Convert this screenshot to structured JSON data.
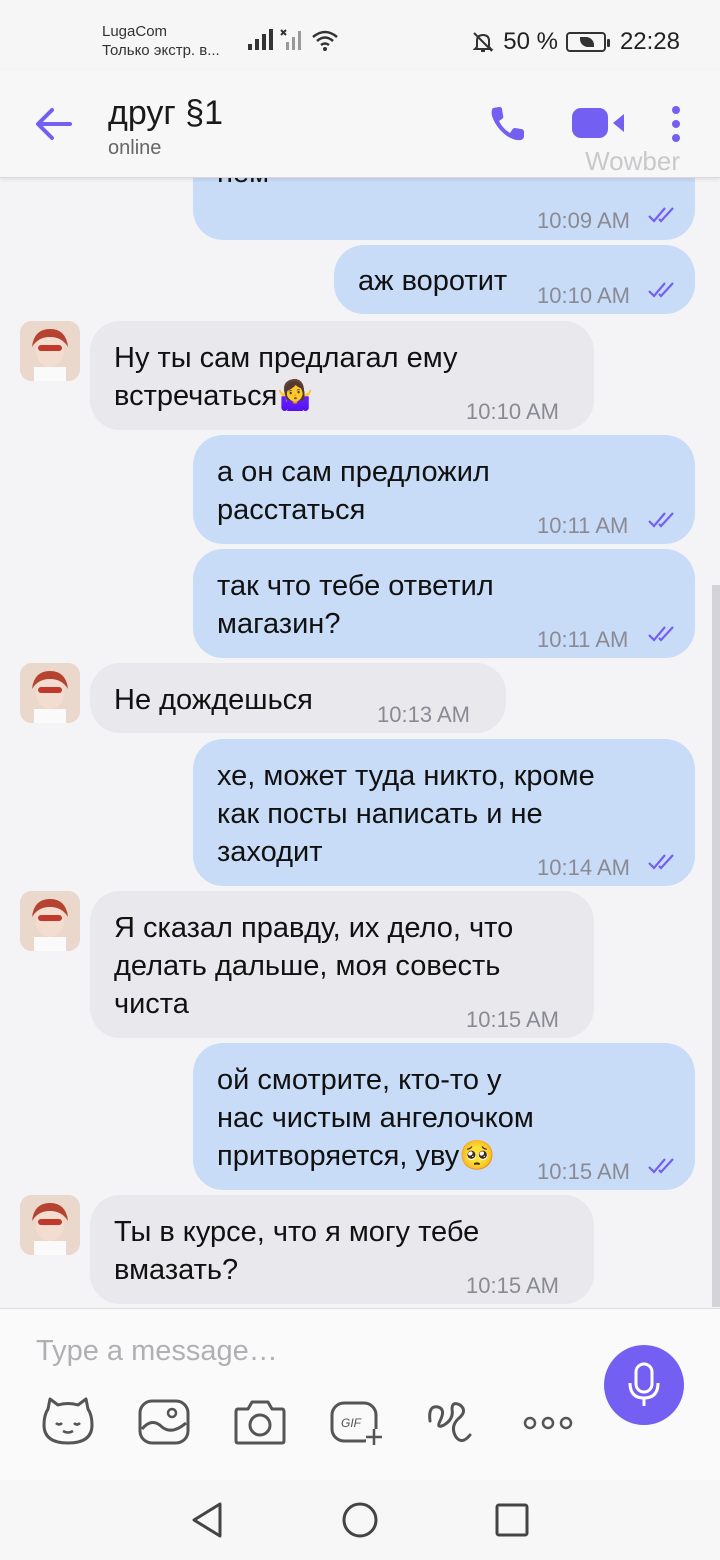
{
  "status_bar": {
    "carrier": "LugaCom",
    "network_note": "Только экстр. в...",
    "battery": "50 %",
    "time": "22:28"
  },
  "header": {
    "title": "друг §1",
    "subtitle": "online",
    "watermark": "Wowber"
  },
  "messages": [
    {
      "dir": "out",
      "text": "хватит говорить о\nнем",
      "time": "10:09 AM"
    },
    {
      "dir": "out",
      "text": "аж воротит",
      "time": "10:10 AM"
    },
    {
      "dir": "in",
      "text": "Ну ты сам предлагал ему\nвстречаться🤷‍♀️",
      "time": "10:10 AM"
    },
    {
      "dir": "out",
      "text": "а он сам предложил\nрасстаться",
      "time": "10:11 AM"
    },
    {
      "dir": "out",
      "text": "так что тебе ответил\nмагазин?",
      "time": "10:11 AM"
    },
    {
      "dir": "in",
      "text": "Не дождешься",
      "time": "10:13 AM"
    },
    {
      "dir": "out",
      "text": "хе, может туда никто, кроме\nкак посты написать и не\nзаходит",
      "time": "10:14 AM"
    },
    {
      "dir": "in",
      "text": "Я сказал правду, их дело, что\nделать дальше, моя совесть\nчиста",
      "time": "10:15 AM"
    },
    {
      "dir": "out",
      "text": "ой смотрите, кто-то у\nнас чистым ангелочком\nпритворяется, уву🥺",
      "time": "10:15 AM"
    },
    {
      "dir": "in",
      "text": "Ты в курсе, что я могу тебе\nвмазать?",
      "time": "10:15 AM"
    }
  ],
  "composer": {
    "placeholder": "Type a message…",
    "gif_label": "GIF"
  },
  "colors": {
    "accent": "#7360f2",
    "outgoing_bubble": "#c9dcf7",
    "incoming_bubble": "#e9e9ed"
  },
  "icons": [
    "back-arrow-icon",
    "phone-icon",
    "video-icon",
    "more-vert-icon",
    "sticker-icon",
    "gallery-icon",
    "camera-icon",
    "gif-icon",
    "doodle-icon",
    "more-horiz-icon",
    "mic-icon",
    "nav-back-icon",
    "nav-home-icon",
    "nav-recents-icon"
  ]
}
